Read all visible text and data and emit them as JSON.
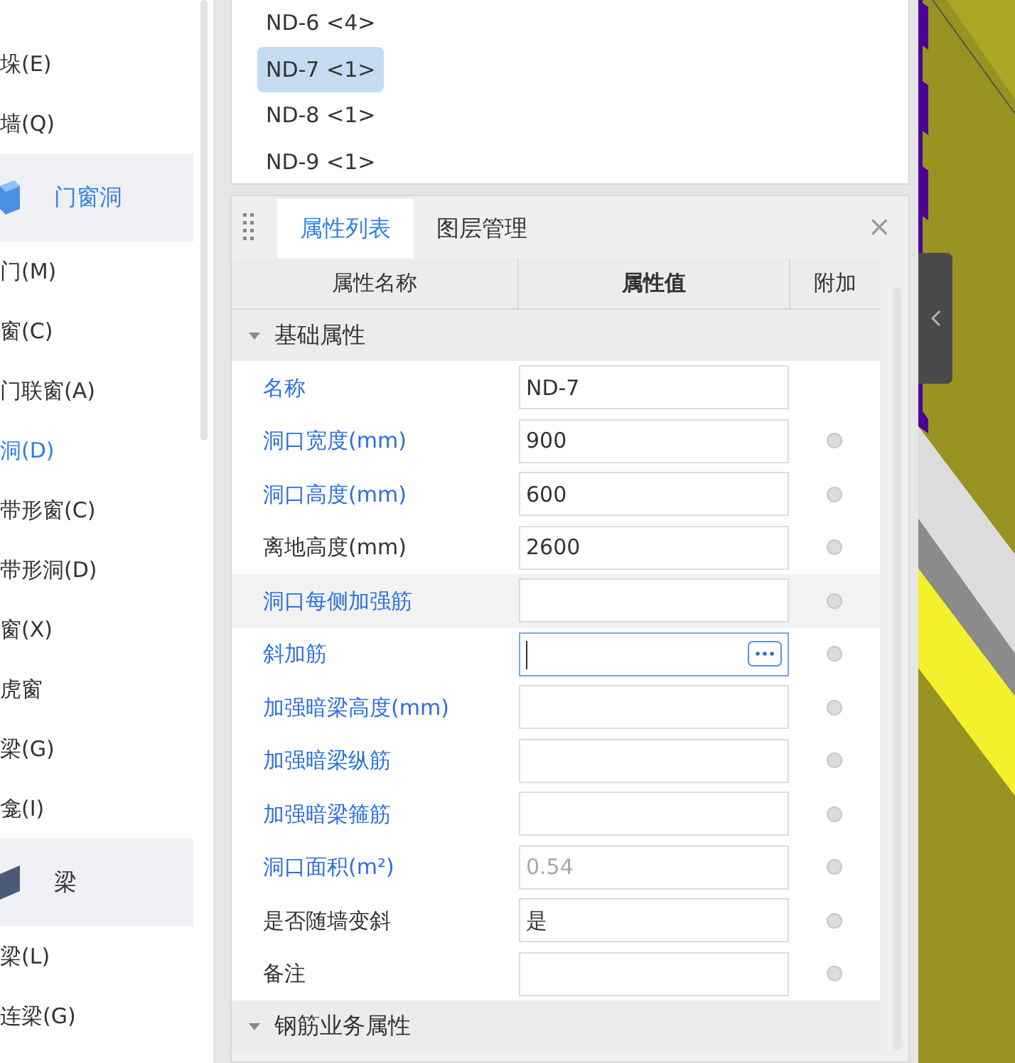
{
  "sidebar": {
    "items": [
      {
        "kind": "item",
        "label": "垛(E)",
        "selected": false
      },
      {
        "kind": "item",
        "label": "墙(Q)",
        "selected": false
      },
      {
        "kind": "opening",
        "label": "门窗洞",
        "selected": false
      },
      {
        "kind": "item",
        "label": "门(M)",
        "selected": false
      },
      {
        "kind": "item",
        "label": "窗(C)",
        "selected": false
      },
      {
        "kind": "item",
        "label": "门联窗(A)",
        "selected": false
      },
      {
        "kind": "item",
        "label": "洞(D)",
        "selected": true
      },
      {
        "kind": "item",
        "label": "带形窗(C)",
        "selected": false
      },
      {
        "kind": "item",
        "label": "带形洞(D)",
        "selected": false
      },
      {
        "kind": "item",
        "label": "窗(X)",
        "selected": false
      },
      {
        "kind": "item",
        "label": "虎窗",
        "selected": false
      },
      {
        "kind": "item",
        "label": "梁(G)",
        "selected": false
      },
      {
        "kind": "item",
        "label": "龛(I)",
        "selected": false
      },
      {
        "kind": "beam",
        "label": "梁",
        "selected": false
      },
      {
        "kind": "item",
        "label": "梁(L)",
        "selected": false
      },
      {
        "kind": "item",
        "label": "连梁(G)",
        "selected": false
      }
    ]
  },
  "component_list": [
    {
      "label": "ND-6 <4>",
      "selected": false
    },
    {
      "label": "ND-7 <1>",
      "selected": true
    },
    {
      "label": "ND-8 <1>",
      "selected": false
    },
    {
      "label": "ND-9 <1>",
      "selected": false
    }
  ],
  "panel": {
    "tabs": [
      {
        "label": "属性列表",
        "selected": true
      },
      {
        "label": "图层管理",
        "selected": false
      }
    ],
    "close": "×",
    "columns": [
      "属性名称",
      "属性值",
      "附加"
    ],
    "groups": [
      {
        "label": "基础属性",
        "expanded": true,
        "rows": [
          {
            "name": "名称",
            "public": true,
            "value": "ND-7",
            "readonly": false,
            "hovered": false,
            "editing": false,
            "extra": false
          },
          {
            "name": "洞口宽度(mm)",
            "public": true,
            "value": "900",
            "readonly": false,
            "hovered": false,
            "editing": false,
            "extra": true
          },
          {
            "name": "洞口高度(mm)",
            "public": true,
            "value": "600",
            "readonly": false,
            "hovered": false,
            "editing": false,
            "extra": true
          },
          {
            "name": "离地高度(mm)",
            "public": false,
            "value": "2600",
            "readonly": false,
            "hovered": false,
            "editing": false,
            "extra": true
          },
          {
            "name": "洞口每侧加强筋",
            "public": true,
            "value": "",
            "readonly": false,
            "hovered": true,
            "editing": false,
            "extra": true
          },
          {
            "name": "斜加筋",
            "public": true,
            "value": "",
            "readonly": false,
            "hovered": false,
            "editing": true,
            "extra": true
          },
          {
            "name": "加强暗梁高度(mm)",
            "public": true,
            "value": "",
            "readonly": false,
            "hovered": false,
            "editing": false,
            "extra": true
          },
          {
            "name": "加强暗梁纵筋",
            "public": true,
            "value": "",
            "readonly": false,
            "hovered": false,
            "editing": false,
            "extra": true
          },
          {
            "name": "加强暗梁箍筋",
            "public": true,
            "value": "",
            "readonly": false,
            "hovered": false,
            "editing": false,
            "extra": true
          },
          {
            "name": "洞口面积(m²)",
            "public": true,
            "value": "0.54",
            "readonly": true,
            "hovered": false,
            "editing": false,
            "extra": true
          },
          {
            "name": "是否随墙变斜",
            "public": false,
            "value": "是",
            "readonly": false,
            "hovered": false,
            "editing": false,
            "extra": true
          },
          {
            "name": "备注",
            "public": false,
            "value": "",
            "readonly": false,
            "hovered": false,
            "editing": false,
            "extra": true
          }
        ]
      },
      {
        "label": "钢筋业务属性",
        "expanded": true
      }
    ]
  }
}
